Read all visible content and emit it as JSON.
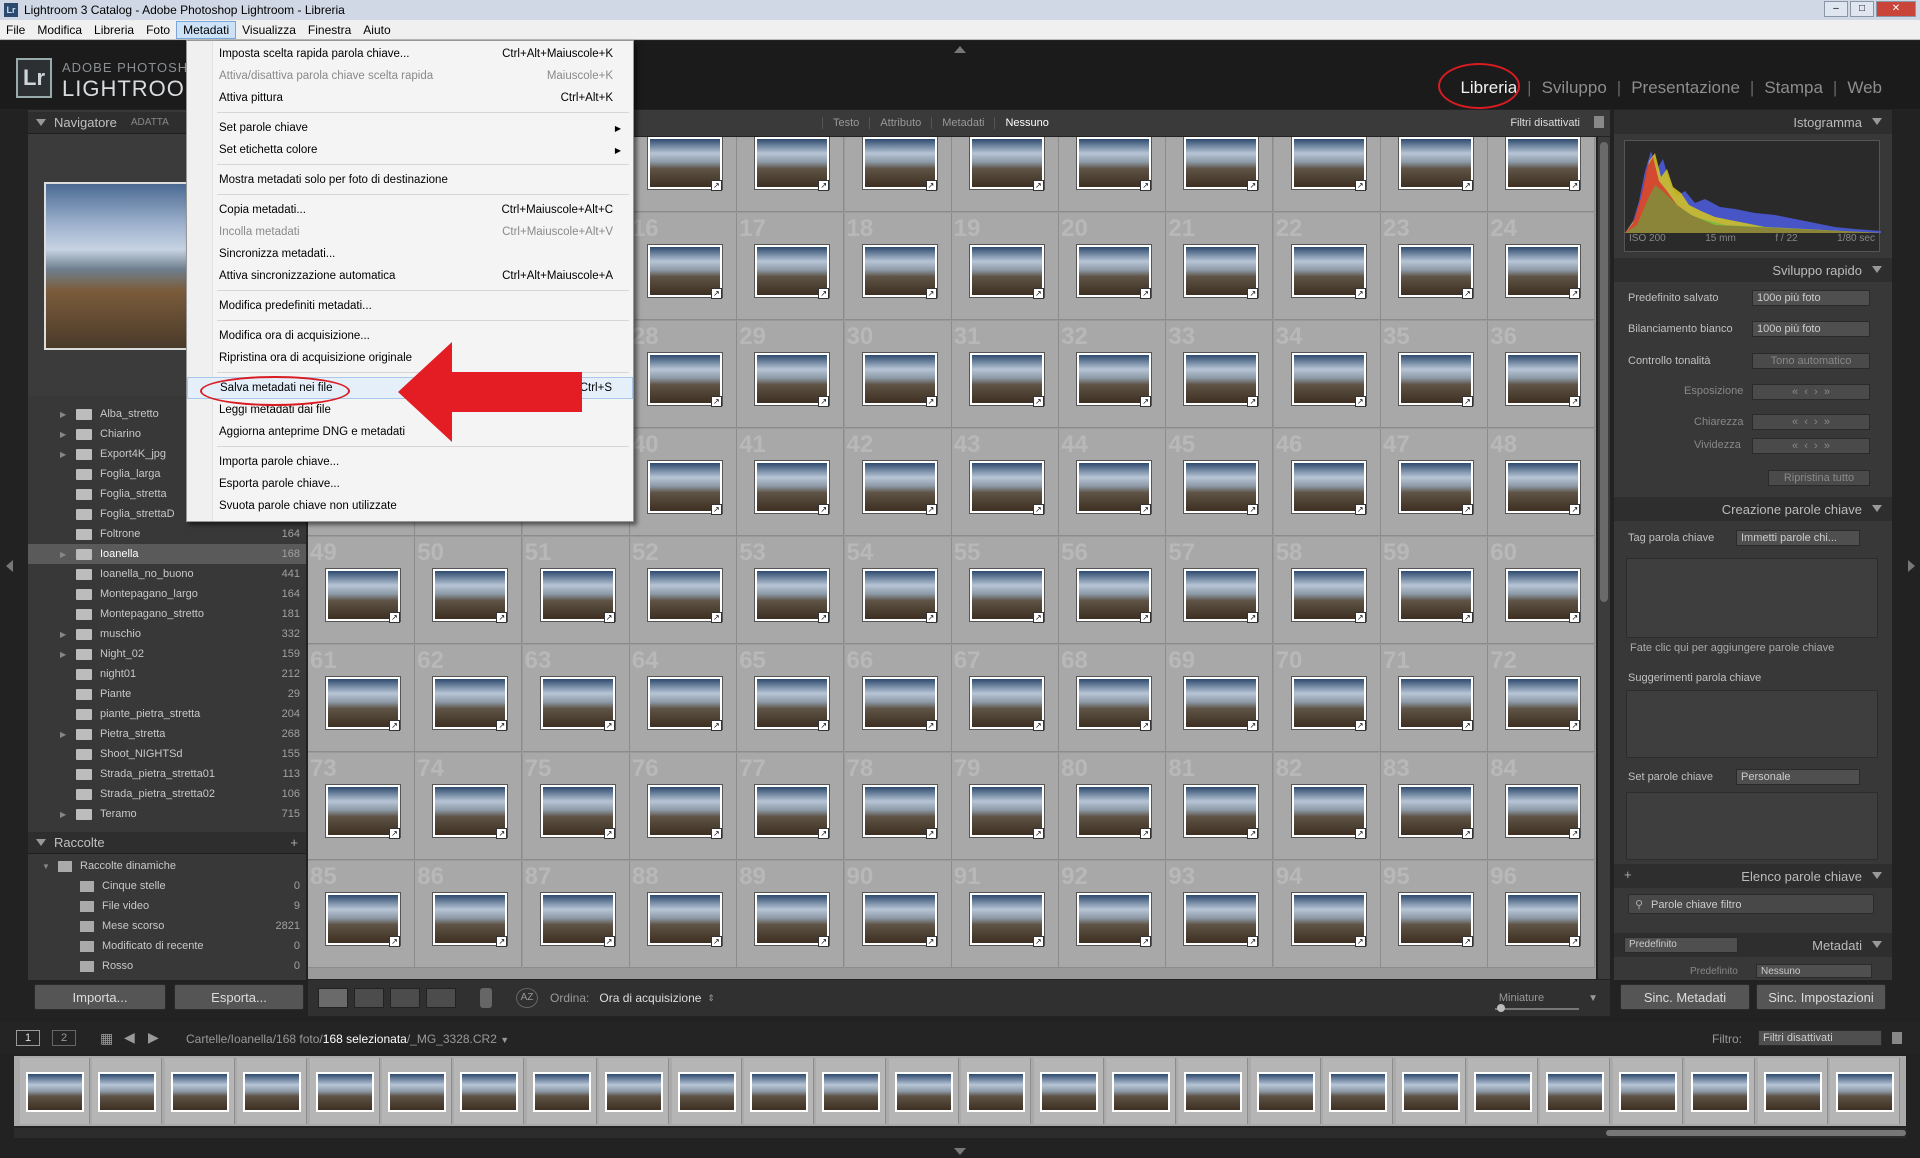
{
  "window": {
    "title": "Lightroom 3 Catalog - Adobe Photoshop Lightroom - Libreria",
    "app_icon": "Lr"
  },
  "menubar": [
    {
      "label": "File"
    },
    {
      "label": "Modifica"
    },
    {
      "label": "Libreria"
    },
    {
      "label": "Foto"
    },
    {
      "label": "Metadati",
      "active": true
    },
    {
      "label": "Visualizza"
    },
    {
      "label": "Finestra"
    },
    {
      "label": "Aiuto"
    }
  ],
  "brand": {
    "line1": "ADOBE PHOTOSHOP",
    "line2": "LIGHTROOM",
    "logo": "Lr"
  },
  "modules": [
    {
      "label": "Libreria",
      "active": true
    },
    {
      "label": "Sviluppo"
    },
    {
      "label": "Presentazione"
    },
    {
      "label": "Stampa"
    },
    {
      "label": "Web"
    }
  ],
  "left": {
    "navigator": {
      "title": "Navigatore",
      "zoom_label": "ADATTA"
    },
    "folders": [
      {
        "name": "Alba_stretto",
        "count": "",
        "expandable": true
      },
      {
        "name": "Chiarino",
        "count": "",
        "expandable": true
      },
      {
        "name": "Export4K_jpg",
        "count": "",
        "expandable": true
      },
      {
        "name": "Foglia_larga",
        "count": "",
        "expandable": false
      },
      {
        "name": "Foglia_stretta",
        "count": "",
        "expandable": false
      },
      {
        "name": "Foglia_strettaD",
        "count": "",
        "expandable": false
      },
      {
        "name": "Foltrone",
        "count": "164",
        "expandable": false
      },
      {
        "name": "Ioanella",
        "count": "168",
        "expandable": true,
        "selected": true
      },
      {
        "name": "Ioanella_no_buono",
        "count": "441",
        "expandable": false
      },
      {
        "name": "Montepagano_largo",
        "count": "164",
        "expandable": false
      },
      {
        "name": "Montepagano_stretto",
        "count": "181",
        "expandable": false
      },
      {
        "name": "muschio",
        "count": "332",
        "expandable": true
      },
      {
        "name": "Night_02",
        "count": "159",
        "expandable": true
      },
      {
        "name": "night01",
        "count": "212",
        "expandable": false
      },
      {
        "name": "Piante",
        "count": "29",
        "expandable": false
      },
      {
        "name": "piante_pietra_stretta",
        "count": "204",
        "expandable": false
      },
      {
        "name": "Pietra_stretta",
        "count": "268",
        "expandable": true
      },
      {
        "name": "Shoot_NIGHTSd",
        "count": "155",
        "expandable": false
      },
      {
        "name": "Strada_pietra_stretta01",
        "count": "113",
        "expandable": false
      },
      {
        "name": "Strada_pietra_stretta02",
        "count": "106",
        "expandable": false
      },
      {
        "name": "Teramo",
        "count": "715",
        "expandable": true
      }
    ],
    "collections": {
      "title": "Raccolte",
      "group": "Raccolte dinamiche",
      "items": [
        {
          "name": "Cinque stelle",
          "count": "0"
        },
        {
          "name": "File video",
          "count": "9"
        },
        {
          "name": "Mese scorso",
          "count": "2821"
        },
        {
          "name": "Modificato di recente",
          "count": "0"
        },
        {
          "name": "Rosso",
          "count": "0"
        }
      ]
    },
    "import_label": "Importa...",
    "export_label": "Esporta..."
  },
  "filterbar": {
    "tabs": [
      {
        "label": "Testo"
      },
      {
        "label": "Attributo"
      },
      {
        "label": "Metadati"
      },
      {
        "label": "Nessuno",
        "active": true
      }
    ],
    "preset": "Filtri disattivati"
  },
  "grid": {
    "start": 1,
    "columns": 12,
    "rows": 8
  },
  "toolbar": {
    "sort_label": "Ordina:",
    "sort_value": "Ora di acquisizione",
    "thumbs_label": "Miniature"
  },
  "right": {
    "histogram": {
      "title": "Istogramma",
      "iso": "ISO 200",
      "focal": "15 mm",
      "aperture": "f / 22",
      "shutter": "1/80 sec"
    },
    "quick_develop": {
      "title": "Sviluppo rapido",
      "preset_label": "Predefinito salvato",
      "preset_value": "100o più foto",
      "wb_label": "Bilanciamento bianco",
      "wb_value": "100o più foto",
      "tone_label": "Controllo tonalità",
      "tone_button": "Tono automatico",
      "exposure": "Esposizione",
      "clarity": "Chiarezza",
      "vibrance": "Vividezza",
      "reset": "Ripristina tutto"
    },
    "keywording": {
      "title": "Creazione parole chiave",
      "tag_label": "Tag parola chiave",
      "tag_value": "Immetti parole chi...",
      "hint": "Fate clic qui per aggiungere parole chiave",
      "suggestions": "Suggerimenti parola chiave",
      "set_label": "Set parole chiave",
      "set_value": "Personale"
    },
    "keyword_list": {
      "title": "Elenco parole chiave",
      "filter_placeholder": "Parole chiave filtro"
    },
    "metadata": {
      "title": "Metadati",
      "preset_dropdown": "Predefinito",
      "preset_label": "Predefinito",
      "preset_value": "Nessuno"
    },
    "sync_metadata": "Sinc. Metadati",
    "sync_settings": "Sinc. Impostazioni"
  },
  "filmstrip": {
    "page1": "1",
    "page2": "2",
    "path": "Cartelle/Ioanella/168 foto/",
    "selected": "168 selezionata",
    "file": "/_MG_3328.CR2",
    "filter_label": "Filtro:",
    "filter_value": "Filtri disattivati",
    "count": 26
  },
  "menu": {
    "items": [
      {
        "label": "Imposta scelta rapida parola chiave...",
        "shortcut": "Ctrl+Alt+Maiuscole+K"
      },
      {
        "label": "Attiva/disattiva parola chiave scelta rapida",
        "shortcut": "Maiuscole+K",
        "disabled": true
      },
      {
        "label": "Attiva pittura",
        "shortcut": "Ctrl+Alt+K"
      },
      {
        "sep": true
      },
      {
        "label": "Set parole chiave",
        "submenu": true
      },
      {
        "label": "Set etichetta colore",
        "submenu": true
      },
      {
        "sep": true
      },
      {
        "label": "Mostra metadati solo per foto di destinazione"
      },
      {
        "sep": true
      },
      {
        "label": "Copia metadati...",
        "shortcut": "Ctrl+Maiuscole+Alt+C"
      },
      {
        "label": "Incolla metadati",
        "shortcut": "Ctrl+Maiuscole+Alt+V",
        "disabled": true
      },
      {
        "label": "Sincronizza metadati..."
      },
      {
        "label": "Attiva sincronizzazione automatica",
        "shortcut": "Ctrl+Alt+Maiuscole+A"
      },
      {
        "sep": true
      },
      {
        "label": "Modifica predefiniti metadati..."
      },
      {
        "sep": true
      },
      {
        "label": "Modifica ora di acquisizione..."
      },
      {
        "label": "Ripristina ora di acquisizione originale"
      },
      {
        "sep": true
      },
      {
        "label": "Salva metadati nei file",
        "shortcut": "Ctrl+S",
        "highlight": true
      },
      {
        "label": "Leggi metadati dai file"
      },
      {
        "label": "Aggiorna anteprime DNG e metadati"
      },
      {
        "sep": true
      },
      {
        "label": "Importa parole chiave..."
      },
      {
        "label": "Esporta parole chiave..."
      },
      {
        "label": "Svuota parole chiave non utilizzate"
      }
    ]
  },
  "colors": {
    "accent_red": "#d81c22",
    "panel": "#383838",
    "grid": "#a8a8a8"
  }
}
